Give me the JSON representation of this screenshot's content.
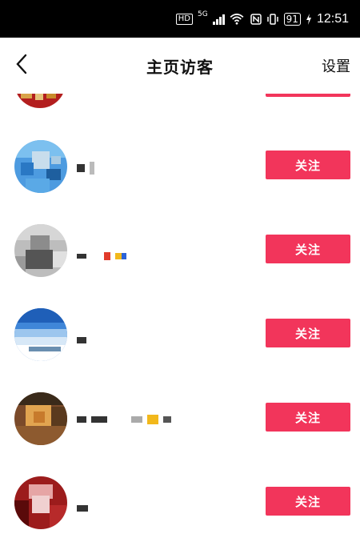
{
  "status_bar": {
    "hd_label": "HD",
    "network_label": "5G",
    "battery_level": "91",
    "time": "12:51"
  },
  "header": {
    "title": "主页访客",
    "settings_label": "设置"
  },
  "visitors": [
    {
      "follow_label": "关注"
    },
    {
      "follow_label": "关注"
    },
    {
      "follow_label": "关注"
    },
    {
      "follow_label": "关注"
    },
    {
      "follow_label": "关注"
    }
  ],
  "colors": {
    "accent": "#f2355b",
    "status_bar_bg": "#000000",
    "background": "#ffffff"
  },
  "icons": {
    "back": "chevron-left-icon",
    "signal": "signal-bars-icon",
    "wifi": "wifi-icon",
    "nfc": "nfc-icon",
    "vibrate": "vibrate-icon",
    "battery": "battery-icon",
    "charging": "charging-bolt-icon"
  }
}
